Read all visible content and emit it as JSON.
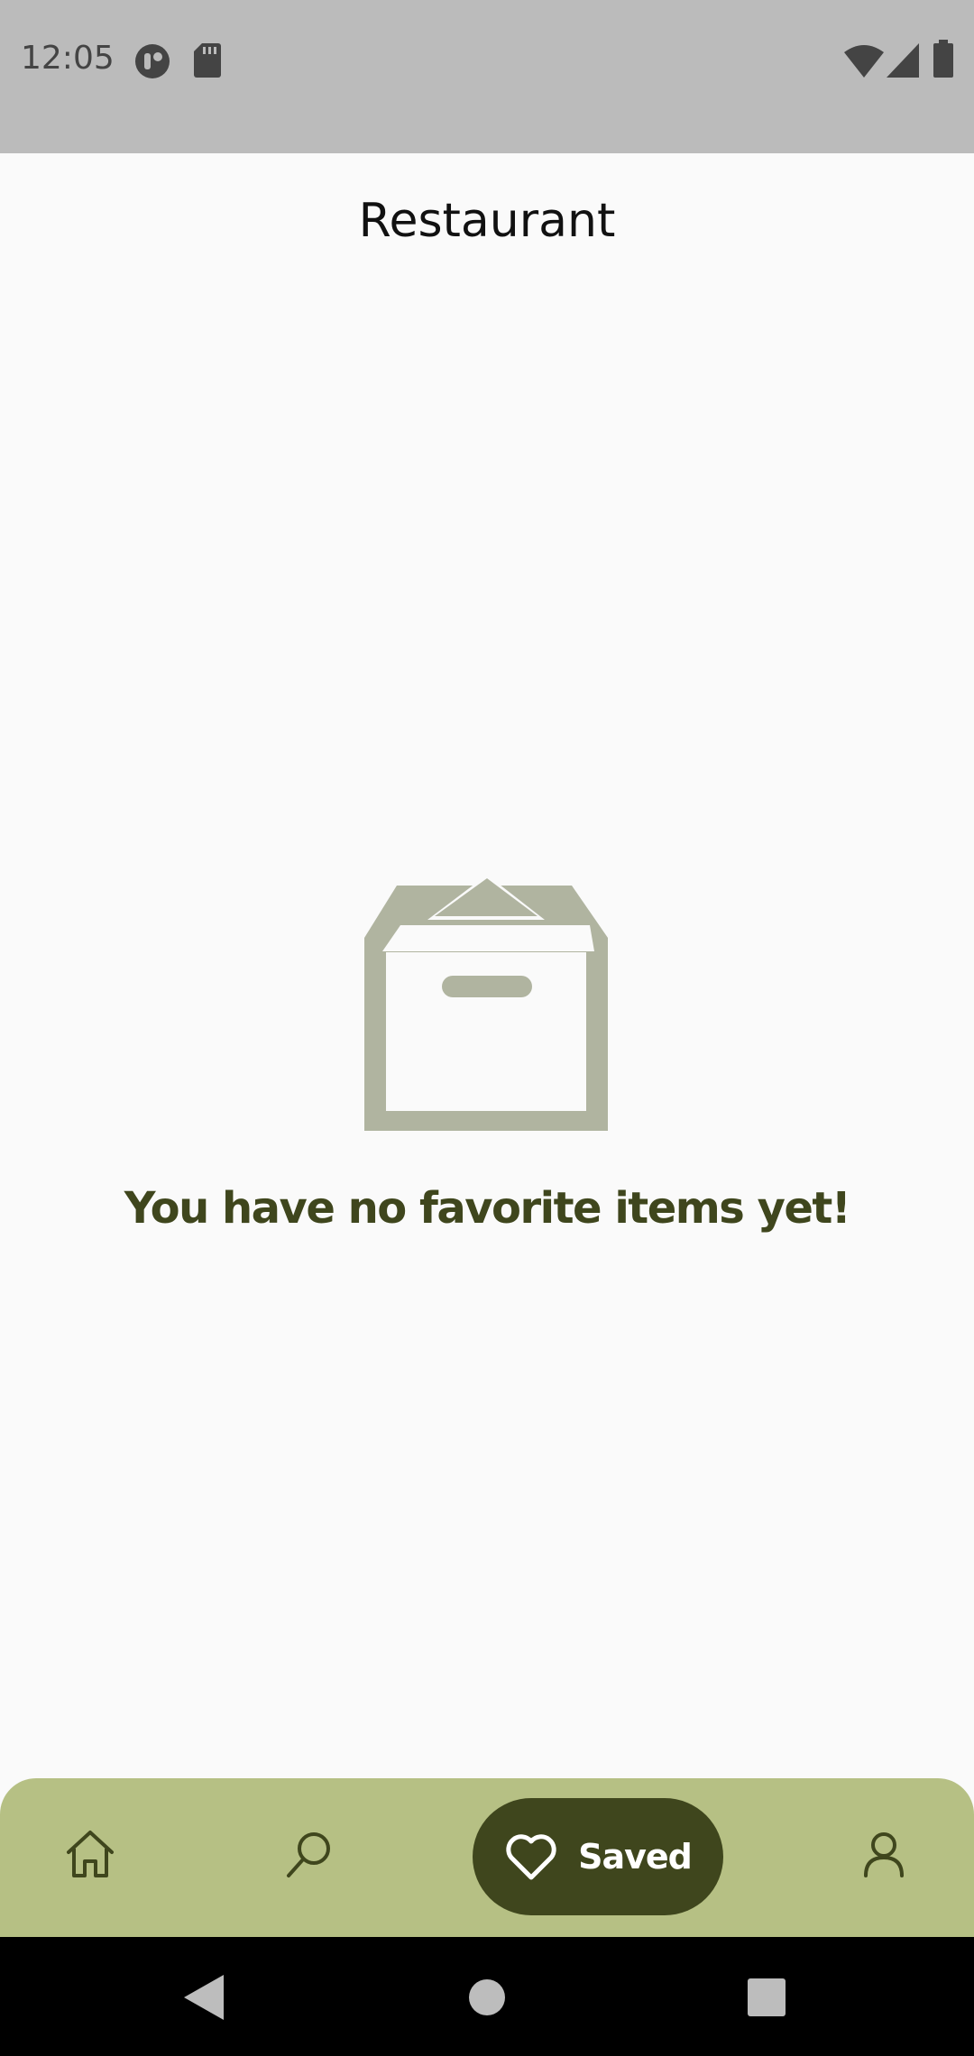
{
  "status_bar": {
    "time": "12:05",
    "icons": [
      "app-notification-icon",
      "sd-card-icon",
      "wifi-icon",
      "cellular-signal-icon",
      "battery-icon"
    ]
  },
  "header": {
    "title": "Restaurant"
  },
  "empty_state": {
    "icon": "empty-box-icon",
    "message": "You have no favorite items yet!"
  },
  "bottom_nav": {
    "items": [
      {
        "id": "home",
        "icon": "home-icon",
        "label": "",
        "active": false
      },
      {
        "id": "search",
        "icon": "search-icon",
        "label": "",
        "active": false
      },
      {
        "id": "saved",
        "icon": "heart-icon",
        "label": "Saved",
        "active": true
      },
      {
        "id": "profile",
        "icon": "user-icon",
        "label": "",
        "active": false
      }
    ]
  },
  "system_nav": {
    "buttons": [
      "back-icon",
      "home-circle-icon",
      "recents-icon"
    ]
  },
  "colors": {
    "status_bar_bg": "#bbbbbb",
    "background": "#fafafa",
    "accent_dark": "#3f461d",
    "nav_bg": "#b6c084",
    "empty_icon": "#b0b4a0"
  }
}
